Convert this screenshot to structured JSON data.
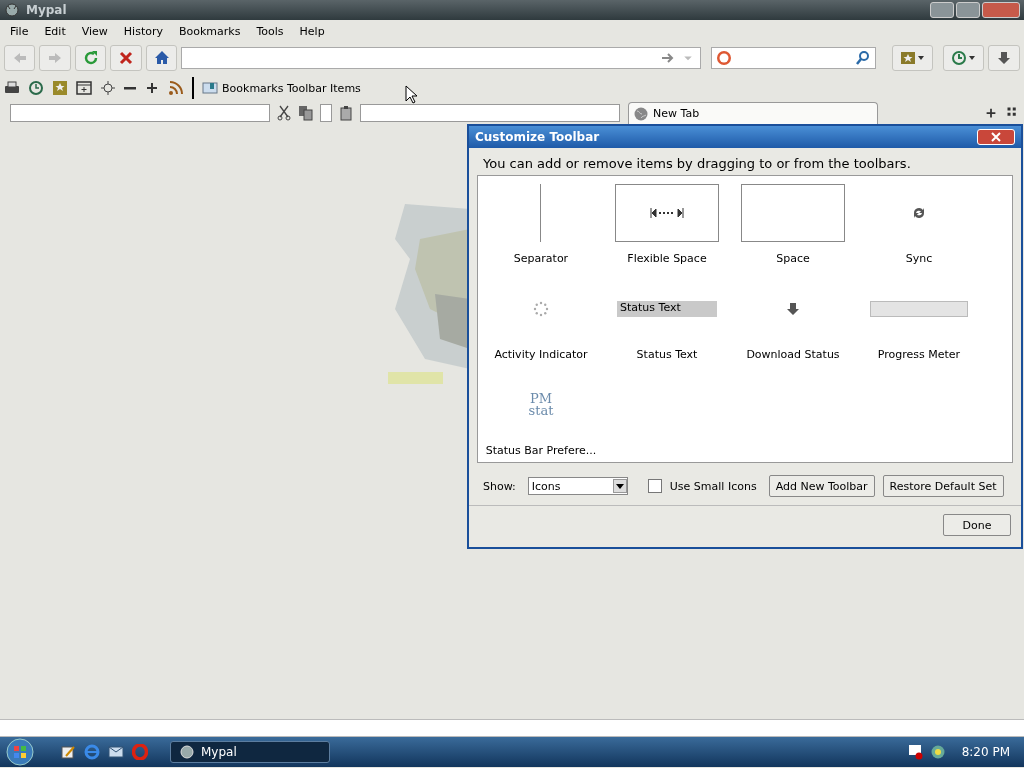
{
  "window": {
    "title": "Mypal"
  },
  "menu": [
    "File",
    "Edit",
    "View",
    "History",
    "Bookmarks",
    "Tools",
    "Help"
  ],
  "toolbar2": {
    "bookmarks_label": "Bookmarks Toolbar Items"
  },
  "tabs": [
    {
      "label": "New Tab",
      "selected": true
    }
  ],
  "dialog": {
    "title": "Customize Toolbar",
    "intro": "You can add or remove items by dragging to or from the toolbars.",
    "items": [
      {
        "kind": "separator",
        "label": "Separator"
      },
      {
        "kind": "flexible",
        "label": "Flexible Space"
      },
      {
        "kind": "space",
        "label": "Space"
      },
      {
        "kind": "sync",
        "label": "Sync"
      },
      {
        "kind": "activity",
        "label": "Activity Indicator"
      },
      {
        "kind": "status",
        "label": "Status Text",
        "preview": "Status Text"
      },
      {
        "kind": "download",
        "label": "Download Status"
      },
      {
        "kind": "progress",
        "label": "Progress Meter"
      },
      {
        "kind": "pm",
        "label": "Status Bar Prefere...",
        "preview": [
          "PM",
          "stat"
        ]
      }
    ],
    "show_label": "Show:",
    "show_value": "Icons",
    "small_icons": {
      "label": "Use Small Icons",
      "checked": false
    },
    "buttons": [
      "Add New Toolbar",
      "Restore Default Set"
    ],
    "done": "Done"
  },
  "taskbar": {
    "task": "Mypal",
    "clock": "8:20 PM"
  }
}
